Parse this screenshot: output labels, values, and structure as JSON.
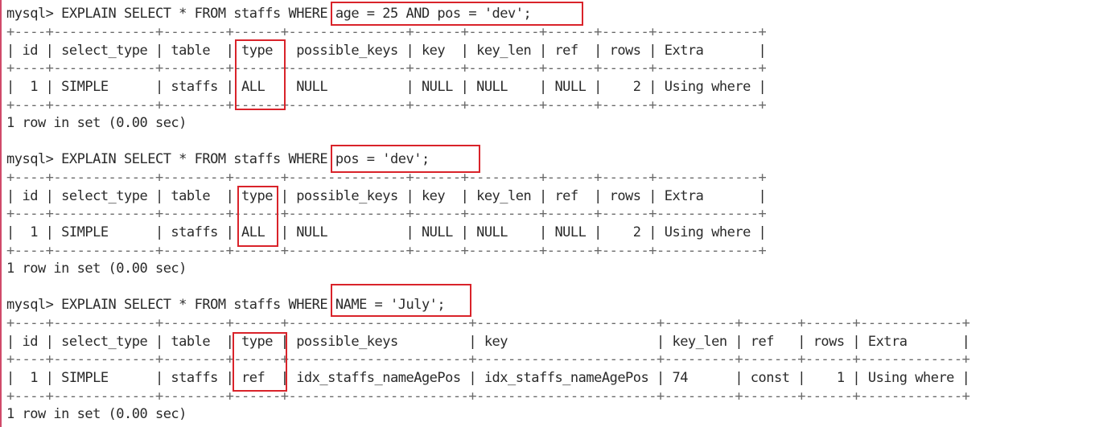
{
  "queries": [
    {
      "prompt_line": "mysql> EXPLAIN SELECT * FROM staffs WHERE age = 25 AND pos = 'dev';",
      "border": "+----+-------------+--------+------+---------------+------+---------+------+------+-------------+",
      "header": "| id | select_type | table  | type | possible_keys | key  | key_len | ref  | rows | Extra       |",
      "row": "|  1 | SIMPLE      | staffs | ALL  | NULL          | NULL | NULL    | NULL |    2 | Using where |",
      "footer": "1 row in set (0.00 sec)"
    },
    {
      "prompt_line": "mysql> EXPLAIN SELECT * FROM staffs WHERE pos = 'dev';",
      "border": "+----+-------------+--------+------+---------------+------+---------+------+------+-------------+",
      "header": "| id | select_type | table  | type | possible_keys | key  | key_len | ref  | rows | Extra       |",
      "row": "|  1 | SIMPLE      | staffs | ALL  | NULL          | NULL | NULL    | NULL |    2 | Using where |",
      "footer": "1 row in set (0.00 sec)"
    },
    {
      "prompt_line": "mysql> EXPLAIN SELECT * FROM staffs WHERE NAME = 'July';",
      "border": "+----+-------------+--------+------+-----------------------+-----------------------+---------+-------+------+-------------+",
      "header": "| id | select_type | table  | type | possible_keys         | key                   | key_len | ref   | rows | Extra       |",
      "row": "|  1 | SIMPLE      | staffs | ref  | idx_staffs_nameAgePos | idx_staffs_nameAgePos | 74      | const |    1 | Using where |",
      "footer": "1 row in set (0.00 sec)"
    }
  ],
  "colors": {
    "highlight": "#d9232a",
    "left_rule": "#d04a6a"
  }
}
